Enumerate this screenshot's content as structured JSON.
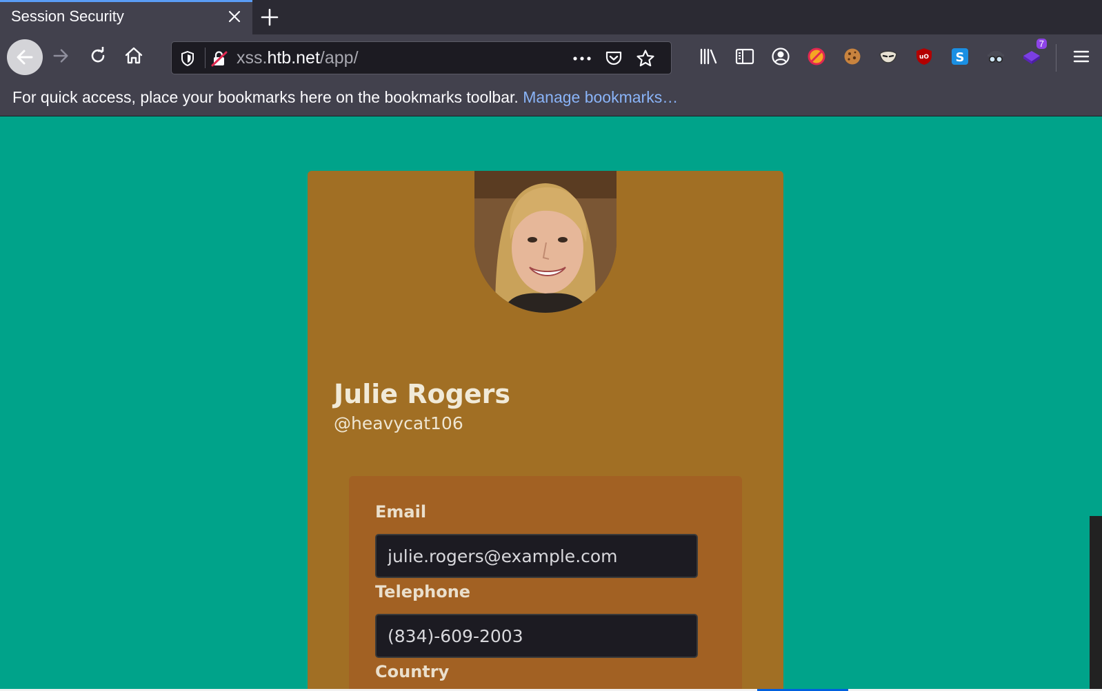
{
  "tab": {
    "title": "Session Security"
  },
  "navbar": {
    "url_prefix": "xss.",
    "url_host": "htb.net",
    "url_path": "/app/",
    "menu_badge": "7"
  },
  "bookmarks": {
    "hint": "For quick access, place your bookmarks here on the bookmarks toolbar.",
    "manage_link": "Manage bookmarks…"
  },
  "profile": {
    "name": "Julie Rogers",
    "handle": "@heavycat106",
    "fields": [
      {
        "label": "Email",
        "value": "julie.rogers@example.com"
      },
      {
        "label": "Telephone",
        "value": "(834)-609-2003"
      },
      {
        "label": "Country",
        "value": ""
      }
    ]
  },
  "colors": {
    "page_bg": "#00a38a",
    "card_bg": "#a16f24",
    "panel_bg": "#a26123",
    "input_bg": "#1c1b22",
    "browser_chrome": "#42414d",
    "tab_accent": "#5a9df5"
  }
}
